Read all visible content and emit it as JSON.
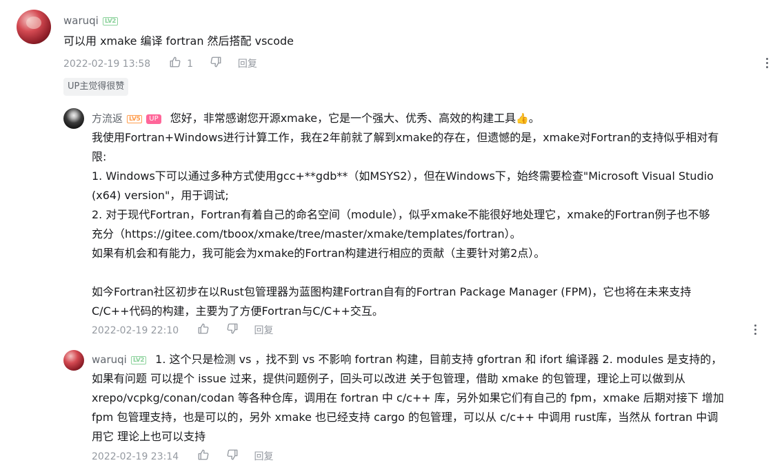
{
  "comment": {
    "username": "waruqi",
    "level": "LV2",
    "content": "可以用 xmake 编译 fortran 然后搭配 vscode",
    "time": "2022-02-19 13:58",
    "like_count": "1",
    "reply_label": "回复",
    "up_tag": "UP主觉得很赞"
  },
  "replies": [
    {
      "username": "方流返",
      "level": "LV5",
      "badge": "UP",
      "lines": [
        "您好，非常感谢您开源xmake，它是一个强大、优秀、高效的构建工具",
        "我使用Fortran+Windows进行计算工作，我在2年前就了解到xmake的存在，但遗憾的是，xmake对Fortran的支持似乎相对有",
        "限:",
        "1. Windows下可以通过多种方式使用gcc+**gdb**（如MSYS2），但在Windows下，始终需要检查\"Microsoft Visual Studio",
        "(x64) version\"，用于调试;",
        "2. 对于现代Fortran，Fortran有着自己的命名空间（module），似乎xmake不能很好地处理它，xmake的Fortran例子也不够",
        "充分（https://gitee.com/tboox/xmake/tree/master/xmake/templates/fortran）。",
        "如果有机会和有能力，我可能会为xmake的Fortran构建进行相应的贡献（主要针对第2点）。",
        "",
        "如今Fortran社区初步在以Rust包管理器为蓝图构建Fortran自有的Fortran Package Manager (FPM)，它也将在未来支持",
        "C/C++代码的构建，主要为了方便Fortran与C/C++交互。"
      ],
      "line1_suffix": "。",
      "time": "2022-02-19 22:10",
      "reply_label": "回复"
    },
    {
      "username": "waruqi",
      "level": "LV2",
      "lines": [
        "1. 这个只是检测 vs ，找不到 vs 不影响 fortran 构建，目前支持 gfortran 和 ifort 编译器 2. modules 是支持的，",
        "如果有问题 可以提个 issue 过来，提供问题例子，回头可以改进    关于包管理，借助 xmake 的包管理，理论上可以做到从",
        "xrepo/vcpkg/conan/codan 等各种仓库，调用在 fortran 中 c/c++ 库，另外如果它们有自己的 fpm，xmake 后期对接下 增加",
        "fpm 包管理支持，也是可以的，另外 xmake 也已经支持 cargo 的包管理，可以从 c/c++ 中调用 rust库，当然从 fortran 中调",
        "用它 理论上也可以支持"
      ],
      "time": "2022-02-19 23:14",
      "reply_label": "回复"
    }
  ]
}
